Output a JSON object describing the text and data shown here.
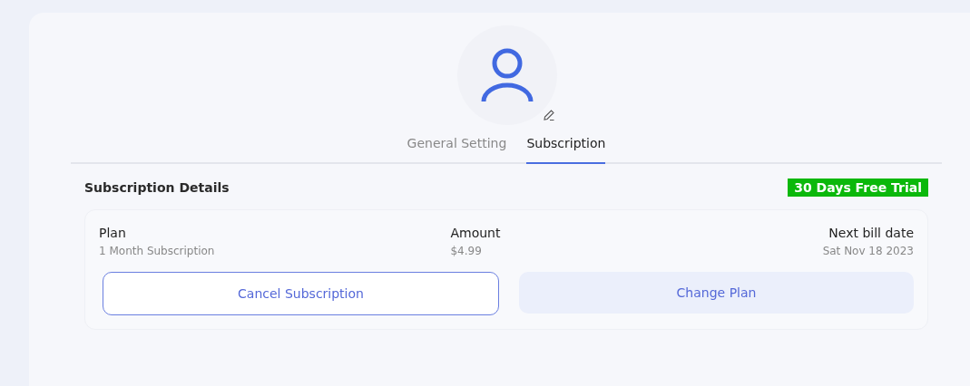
{
  "tabs": [
    {
      "label": "General Setting",
      "selected": false
    },
    {
      "label": "Subscription",
      "selected": true
    }
  ],
  "details": {
    "title": "Subscription Details",
    "badge": "30 Days Free Trial",
    "fields": [
      {
        "label": "Plan",
        "value": "1 Month Subscription"
      },
      {
        "label": "Amount",
        "value": "$4.99"
      },
      {
        "label": "Next bill date",
        "value": "Sat Nov 18 2023"
      }
    ],
    "buttons": [
      {
        "label": "Cancel Subscription",
        "kind": "outline"
      },
      {
        "label": "Change Plan",
        "kind": "filled"
      }
    ]
  }
}
